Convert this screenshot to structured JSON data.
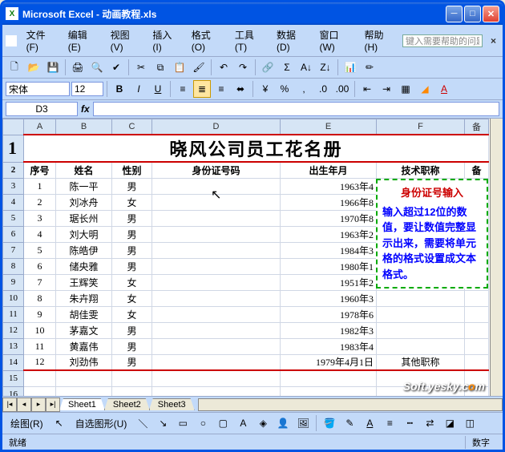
{
  "window": {
    "title": "Microsoft Excel - 动画教程.xls"
  },
  "menu": {
    "file": "文件(F)",
    "edit": "编辑(E)",
    "view": "视图(V)",
    "insert": "插入(I)",
    "format": "格式(O)",
    "tools": "工具(T)",
    "data": "数据(D)",
    "window": "窗口(W)",
    "help": "帮助(H)",
    "help_placeholder": "键入需要帮助的问题"
  },
  "formatbar": {
    "font": "宋体",
    "size": "12"
  },
  "formula": {
    "cell_ref": "D3"
  },
  "columns": [
    "A",
    "B",
    "C",
    "D",
    "E",
    "F",
    "备"
  ],
  "sheet_title": "晓风公司员工花名册",
  "headers": {
    "no": "序号",
    "name": "姓名",
    "sex": "性别",
    "id": "身份证号码",
    "birth": "出生年月",
    "title": "技术职称",
    "note": "备"
  },
  "rows": [
    {
      "no": "1",
      "name": "陈一平",
      "sex": "男",
      "id": "",
      "birth": "1963年4",
      "title": ""
    },
    {
      "no": "2",
      "name": "刘冰舟",
      "sex": "女",
      "id": "",
      "birth": "1966年8",
      "title": ""
    },
    {
      "no": "3",
      "name": "琚长州",
      "sex": "男",
      "id": "",
      "birth": "1970年8",
      "title": ""
    },
    {
      "no": "4",
      "name": "刘大明",
      "sex": "男",
      "id": "",
      "birth": "1963年2",
      "title": ""
    },
    {
      "no": "5",
      "name": "陈皓伊",
      "sex": "男",
      "id": "",
      "birth": "1984年3",
      "title": ""
    },
    {
      "no": "6",
      "name": "储央雅",
      "sex": "男",
      "id": "",
      "birth": "1980年1",
      "title": ""
    },
    {
      "no": "7",
      "name": "王辉笑",
      "sex": "女",
      "id": "",
      "birth": "1951年2",
      "title": ""
    },
    {
      "no": "8",
      "name": "朱卉翔",
      "sex": "女",
      "id": "",
      "birth": "1960年3",
      "title": ""
    },
    {
      "no": "9",
      "name": "胡佳雯",
      "sex": "女",
      "id": "",
      "birth": "1978年6",
      "title": ""
    },
    {
      "no": "10",
      "name": "茅嘉文",
      "sex": "男",
      "id": "",
      "birth": "1982年3",
      "title": ""
    },
    {
      "no": "11",
      "name": "黄嘉伟",
      "sex": "男",
      "id": "",
      "birth": "1983年4",
      "title": ""
    },
    {
      "no": "12",
      "name": "刘劲伟",
      "sex": "男",
      "id": "",
      "birth": "1979年4月1日",
      "title": "其他职称"
    }
  ],
  "tooltip": {
    "title": "身份证号输入",
    "body": "输入超过12位的数值，要让数值完整显示出来，需要将单元格的格式设置成文本格式。"
  },
  "tabs": {
    "s1": "Sheet1",
    "s2": "Sheet2",
    "s3": "Sheet3"
  },
  "drawbar": {
    "draw": "绘图(R)",
    "autoshape": "自选图形(U)"
  },
  "status": {
    "ready": "就绪",
    "num": "数字"
  },
  "watermark": "Soft.yesky."
}
